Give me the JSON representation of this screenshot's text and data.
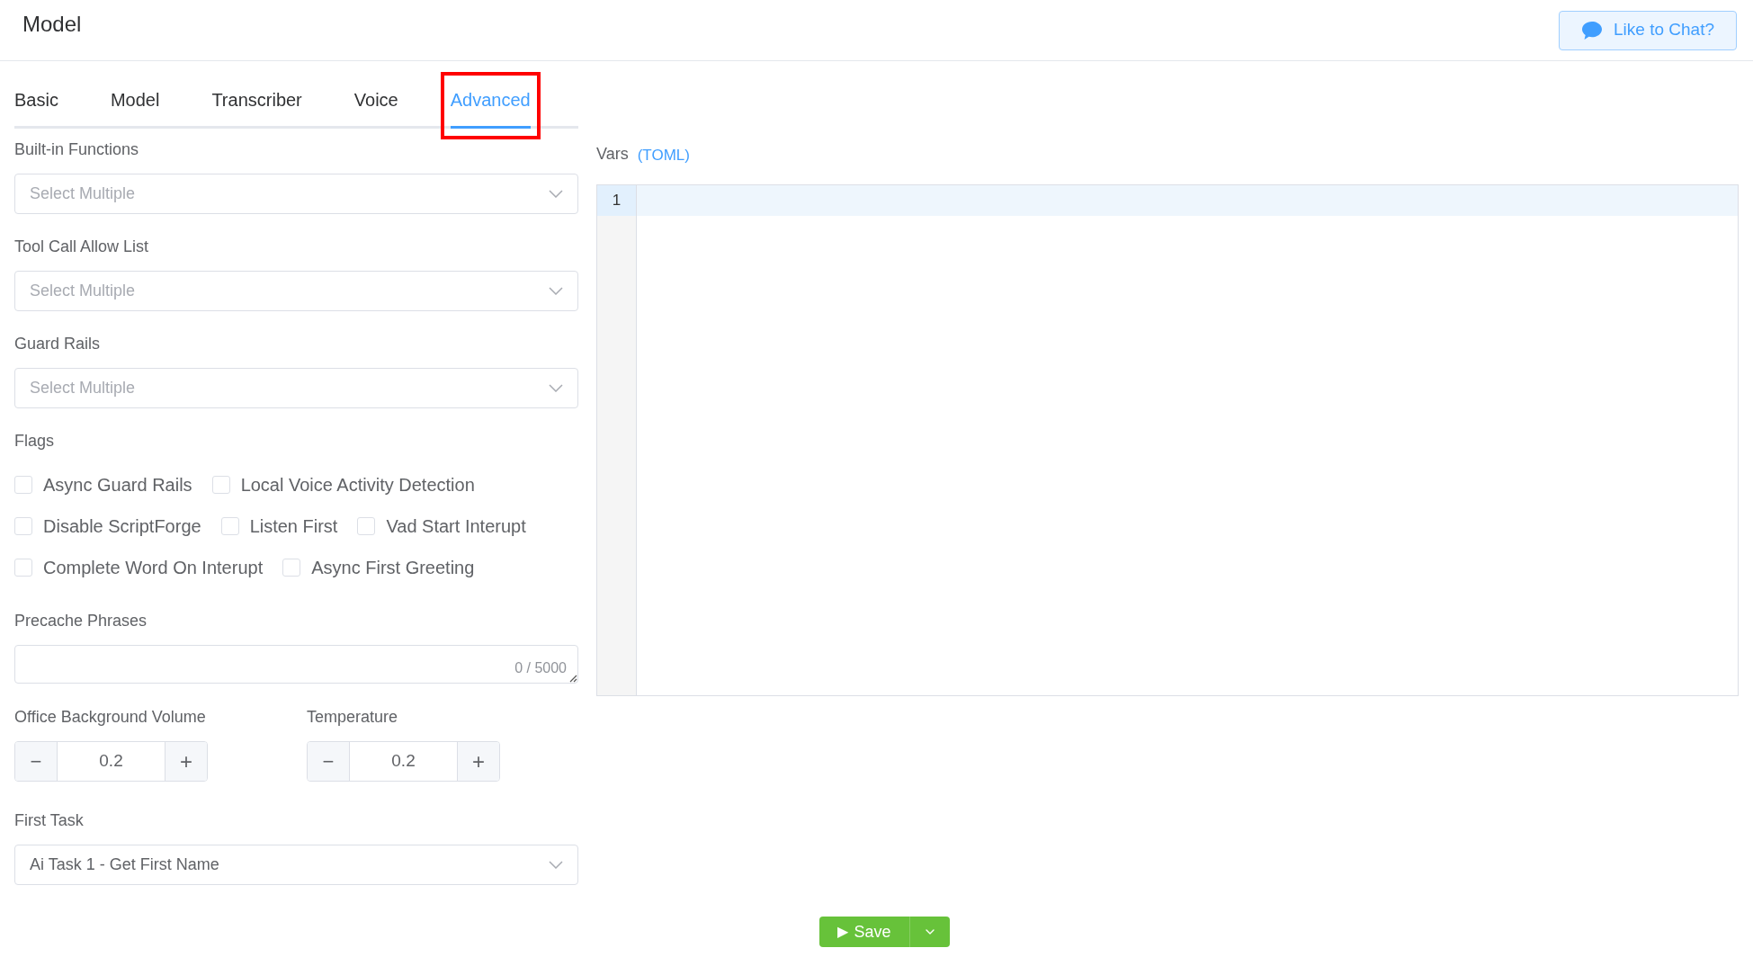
{
  "header": {
    "title": "Model",
    "chat_button": "Like to Chat?"
  },
  "tabs": [
    {
      "label": "Basic",
      "selected": false,
      "highlighted": false
    },
    {
      "label": "Model",
      "selected": false,
      "highlighted": false
    },
    {
      "label": "Transcriber",
      "selected": false,
      "highlighted": false
    },
    {
      "label": "Voice",
      "selected": false,
      "highlighted": false
    },
    {
      "label": "Advanced",
      "selected": true,
      "highlighted": true
    }
  ],
  "selects": [
    {
      "label": "Built-in Functions",
      "placeholder": "Select Multiple"
    },
    {
      "label": "Tool Call Allow List",
      "placeholder": "Select Multiple"
    },
    {
      "label": "Guard Rails",
      "placeholder": "Select Multiple"
    }
  ],
  "flags": {
    "label": "Flags",
    "rows": [
      [
        {
          "label": "Async Guard Rails",
          "checked": false
        },
        {
          "label": "Local Voice Activity Detection",
          "checked": false
        }
      ],
      [
        {
          "label": "Disable ScriptForge",
          "checked": false
        },
        {
          "label": "Listen First",
          "checked": false
        },
        {
          "label": "Vad Start Interupt",
          "checked": false
        }
      ],
      [
        {
          "label": "Complete Word On Interupt",
          "checked": false
        },
        {
          "label": "Async First Greeting",
          "checked": false
        }
      ]
    ]
  },
  "precache": {
    "label": "Precache Phrases",
    "counter": "0 / 5000"
  },
  "steppers": [
    {
      "label": "Office Background Volume",
      "value": "0.2",
      "minus": "−",
      "plus": "+"
    },
    {
      "label": "Temperature",
      "value": "0.2",
      "minus": "−",
      "plus": "+"
    }
  ],
  "first_task": {
    "label": "First Task",
    "value": "Ai Task 1 - Get First Name"
  },
  "vars": {
    "label": "Vars",
    "format": "(TOML)",
    "line_numbers": [
      "1"
    ]
  },
  "save_button": {
    "label": "Save",
    "icon": "▶"
  }
}
